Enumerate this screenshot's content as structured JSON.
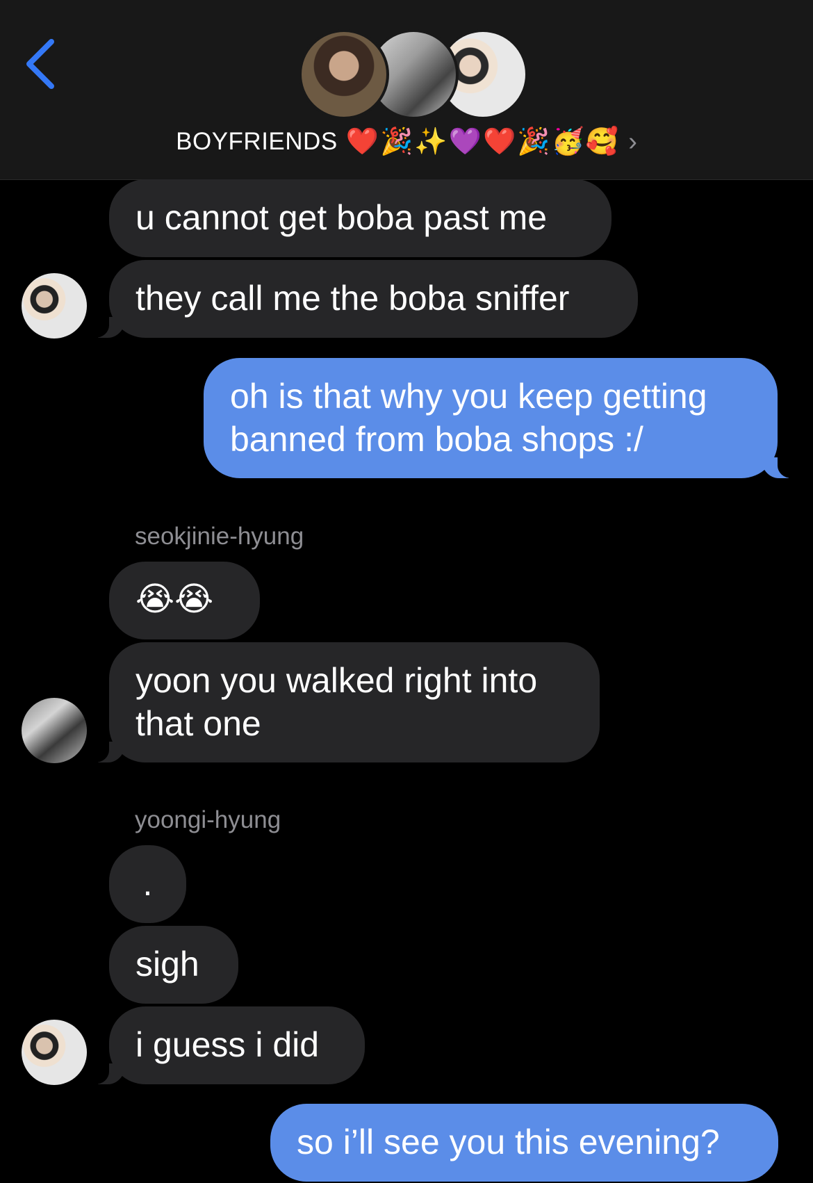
{
  "header": {
    "back_icon": "chevron-left-icon",
    "group_name": "BOYFRIENDS",
    "title_emoji": "❤️🎉✨💜❤️🎉🥳🥰",
    "disclosure": "›",
    "accent_color": "#3478f6"
  },
  "messages": [
    {
      "id": "m1",
      "dir": "in",
      "text": "u cannot get boba past me"
    },
    {
      "id": "m2",
      "dir": "in",
      "text": "they call me the boba sniffer"
    },
    {
      "id": "m3",
      "dir": "out",
      "line1": "oh is that why you keep getting",
      "line2": "banned from boba shops :/"
    },
    {
      "id": "m4",
      "dir": "in",
      "text": "😭😭"
    },
    {
      "id": "m5",
      "dir": "in",
      "line1": "yoon you walked right into",
      "line2": "that one"
    },
    {
      "id": "m6",
      "dir": "in",
      "text": "."
    },
    {
      "id": "m7",
      "dir": "in",
      "text": "sigh"
    },
    {
      "id": "m8",
      "dir": "in",
      "text": "i guess i did"
    },
    {
      "id": "m9",
      "dir": "out",
      "text": "so i’ll see you this evening?"
    }
  ],
  "senders": {
    "seokjin": "seokjinie-hyung",
    "yoongi": "yoongi-hyung"
  },
  "colors": {
    "incoming_bubble": "#262628",
    "outgoing_bubble": "#5b8de8",
    "background": "#000000",
    "sender_label": "#8e8e93"
  }
}
